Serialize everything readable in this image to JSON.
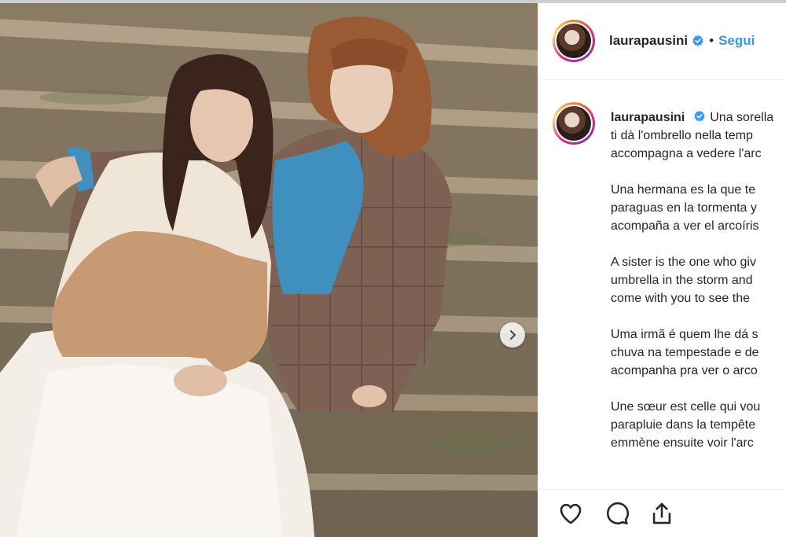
{
  "post": {
    "username": "laurapausini",
    "separator": "•",
    "follow_label": "Segui",
    "verified_icon": "verified-badge-icon",
    "next_icon": "chevron-right-icon"
  },
  "caption": {
    "paragraphs": [
      "Una sorella è quella che ti dà l'ombrello nella tempesta e poi ti accompagna a vedere l'arcobaleno",
      "Una hermana es la que te da el paraguas en la tormenta y luego te acompaña a ver el arcoíris",
      "A sister is the one who gives you an umbrella in the storm and then will come with you to see the rainbow",
      "Uma irmã é quem lhe dá sombrinha de chuva na tempestade e depois te acompanha pra ver o arco-íris",
      "Une sœur est celle qui vous donne le parapluie dans la tempête et qui vous emmène ensuite voir l'arc-en-ciel"
    ],
    "lines": [
      [
        "Una sorella",
        "ti dà l'ombrello nella temp",
        "accompagna a vedere l'arc"
      ],
      [
        "Una hermana es la que te",
        "paraguas en la tormenta y",
        "acompaña a ver el arcoíris"
      ],
      [
        "A sister is the one who giv",
        "umbrella in the storm and",
        "come with you to see the"
      ],
      [
        "Uma irmã é quem lhe dá s",
        "chuva na tempestade e de",
        "acompanha pra ver o arco"
      ],
      [
        "Une sœur est celle qui vou",
        "parapluie dans la tempête",
        "emmène ensuite voir l'arc"
      ]
    ]
  },
  "actions": {
    "like_icon": "heart-icon",
    "comment_icon": "comment-icon",
    "share_icon": "share-icon"
  },
  "colors": {
    "follow": "#3897f0",
    "verified": "#3897f0",
    "text": "#262626",
    "divider": "#efefef"
  }
}
